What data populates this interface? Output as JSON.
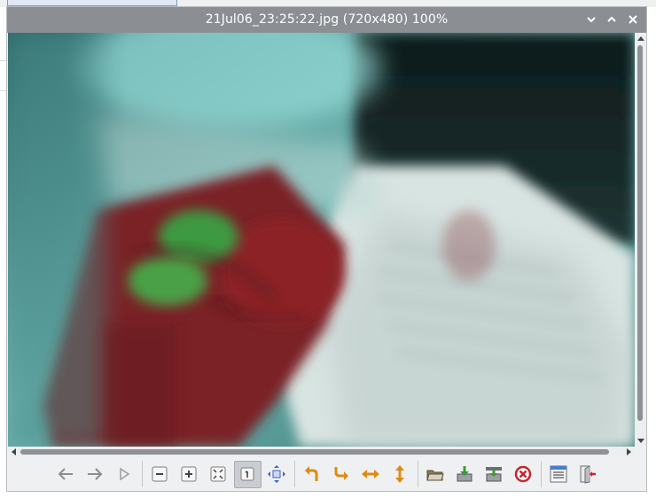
{
  "window": {
    "title": "21Jul06_23:25:22.jpg (720x480) 100%",
    "buttons": {
      "minimize": "⌄",
      "maximize": "⌃",
      "close": "✕"
    }
  },
  "image": {
    "description_icon": "blurred-photo",
    "colors": {
      "teal": "#3f7d7d",
      "red": "#7e2127",
      "green": "#3c9440",
      "white": "#d6e2df",
      "dark": "#0f1d1e"
    }
  },
  "toolbar": {
    "items": [
      {
        "name": "previous-button",
        "icon": "arrow-left-icon"
      },
      {
        "name": "next-button",
        "icon": "arrow-right-icon"
      },
      {
        "name": "slideshow-button",
        "icon": "play-icon"
      },
      {
        "name": "zoom-out-button",
        "icon": "zoom-out-icon"
      },
      {
        "name": "zoom-in-button",
        "icon": "zoom-in-icon"
      },
      {
        "name": "fit-window-button",
        "icon": "fit-icon"
      },
      {
        "name": "original-size-button",
        "icon": "original-size-icon",
        "active": true
      },
      {
        "name": "fullscreen-button",
        "icon": "fullscreen-icon"
      },
      {
        "name": "rotate-ccw-button",
        "icon": "rotate-ccw-icon"
      },
      {
        "name": "rotate-cw-button",
        "icon": "rotate-cw-icon"
      },
      {
        "name": "flip-horizontal-button",
        "icon": "flip-horizontal-icon"
      },
      {
        "name": "flip-vertical-button",
        "icon": "flip-vertical-icon"
      },
      {
        "name": "open-file-button",
        "icon": "open-folder-icon"
      },
      {
        "name": "save-button",
        "icon": "save-icon"
      },
      {
        "name": "save-as-button",
        "icon": "save-as-icon"
      },
      {
        "name": "delete-button",
        "icon": "delete-icon"
      },
      {
        "name": "preferences-button",
        "icon": "preferences-icon"
      },
      {
        "name": "quit-button",
        "icon": "quit-icon"
      }
    ]
  }
}
